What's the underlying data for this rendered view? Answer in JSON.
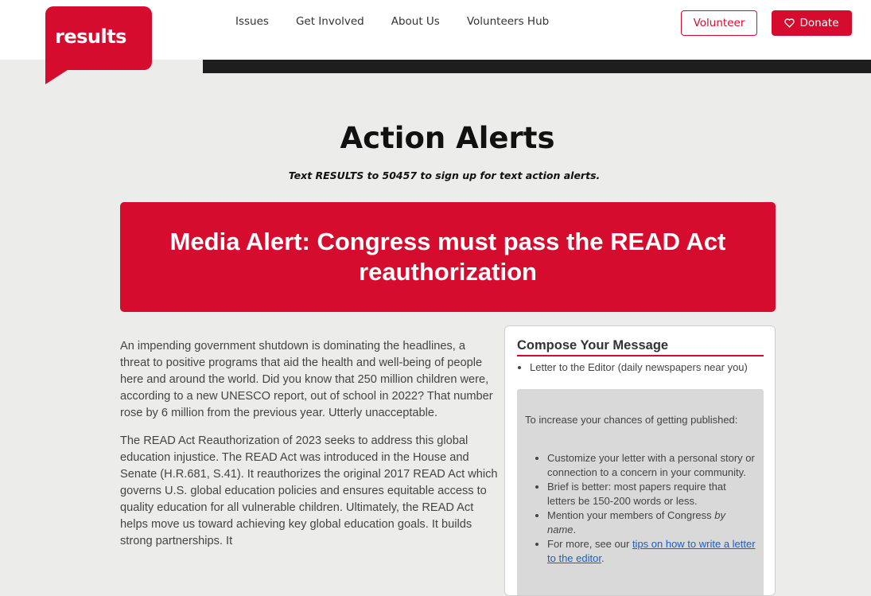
{
  "header": {
    "logo_text": "results",
    "nav": [
      "Issues",
      "Get Involved",
      "About Us",
      "Volunteers Hub"
    ],
    "volunteer_label": "Volunteer",
    "donate_label": "Donate",
    "brand_color": "#d50c2e"
  },
  "main": {
    "title": "Action Alerts",
    "subtitle": "Text RESULTS to 50457 to sign up for text action alerts.",
    "alert_title": "Media Alert: Congress must pass the READ Act reauthorization",
    "paragraphs": [
      "An impending government shutdown is dominating the headlines, a threat to positive programs that aid the health and well-being of people here and around the world. Did you know that 250 million children were, according to a new UNESCO report, out of school in 2022? That number rose by 6 million from the previous year. Utterly unacceptable.",
      "The READ Act Reauthorization of 2023 seeks to address this global education injustice. The READ Act was introduced in the House and Senate (H.R.681, S.41). It reauthorizes the original 2017 READ Act which governs U.S. global education policies and ensures equitable access to quality education for all vulnerable children. Ultimately, the READ Act helps move us toward achieving key global education goals. It builds strong partnerships. It"
    ]
  },
  "compose": {
    "title": "Compose Your Message",
    "options": [
      "Letter to the Editor (daily newspapers near you)"
    ],
    "tips_intro": "To increase your chances of getting published:",
    "tip1": "Customize your letter with a personal story or connection to a concern in your community.",
    "tip2": "Brief is better: most papers require that letters be 150-200 words or less.",
    "tip3_prefix": "Mention your members of Congress ",
    "tip3_emph": "by name",
    "tip3_suffix": ".",
    "tip4_prefix": "For more, see our ",
    "tip4_link": "tips on how to write a letter to the editor",
    "tip4_suffix": "."
  }
}
